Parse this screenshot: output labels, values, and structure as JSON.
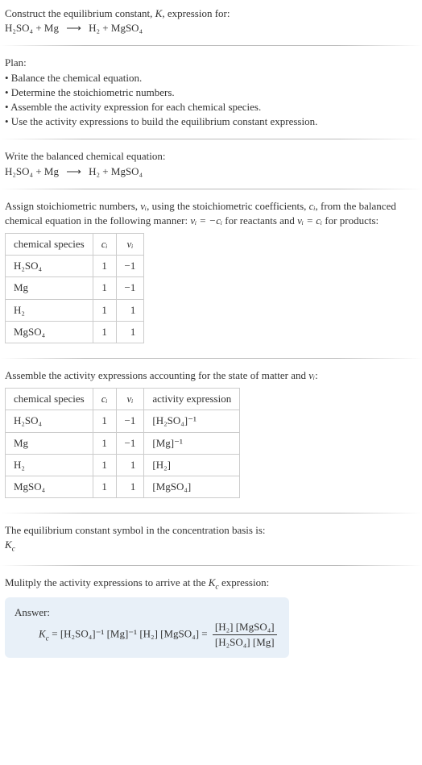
{
  "header": {
    "line1_pre": "Construct the equilibrium constant, ",
    "line1_K": "K",
    "line1_post": ", expression for:",
    "eq_lhs1": "H₂SO₄",
    "eq_plus": " + ",
    "eq_lhs2": "Mg",
    "eq_arrow": "⟶",
    "eq_rhs1": "H₂",
    "eq_rhs2": "MgSO₄"
  },
  "plan": {
    "title": "Plan:",
    "b1": "• Balance the chemical equation.",
    "b2": "• Determine the stoichiometric numbers.",
    "b3": "• Assemble the activity expression for each chemical species.",
    "b4": "• Use the activity expressions to build the equilibrium constant expression."
  },
  "balanced": {
    "title": "Write the balanced chemical equation:",
    "lhs1": "H₂SO₄",
    "plus": " + ",
    "lhs2": "Mg",
    "arrow": "⟶",
    "rhs1": "H₂",
    "rhs2": "MgSO₄"
  },
  "assign": {
    "p1a": "Assign stoichiometric numbers, ",
    "nu_i": "νᵢ",
    "p1b": ", using the stoichiometric coefficients, ",
    "c_i": "cᵢ",
    "p1c": ", from the balanced chemical equation in the following manner: ",
    "eq1": "νᵢ = −cᵢ",
    "p1d": " for reactants and ",
    "eq2": "νᵢ = cᵢ",
    "p1e": " for products:",
    "th1": "chemical species",
    "th2": "cᵢ",
    "th3": "νᵢ",
    "rows": [
      {
        "sp": "H₂SO₄",
        "c": "1",
        "n": "−1"
      },
      {
        "sp": "Mg",
        "c": "1",
        "n": "−1"
      },
      {
        "sp": "H₂",
        "c": "1",
        "n": "1"
      },
      {
        "sp": "MgSO₄",
        "c": "1",
        "n": "1"
      }
    ]
  },
  "activity": {
    "title_a": "Assemble the activity expressions accounting for the state of matter and ",
    "title_nu": "νᵢ",
    "title_b": ":",
    "th1": "chemical species",
    "th2": "cᵢ",
    "th3": "νᵢ",
    "th4": "activity expression",
    "rows": [
      {
        "sp": "H₂SO₄",
        "c": "1",
        "n": "−1",
        "act": "[H₂SO₄]⁻¹"
      },
      {
        "sp": "Mg",
        "c": "1",
        "n": "−1",
        "act": "[Mg]⁻¹"
      },
      {
        "sp": "H₂",
        "c": "1",
        "n": "1",
        "act": "[H₂]"
      },
      {
        "sp": "MgSO₄",
        "c": "1",
        "n": "1",
        "act": "[MgSO₄]"
      }
    ]
  },
  "symbol": {
    "line": "The equilibrium constant symbol in the concentration basis is:",
    "kc": "K",
    "kc_sub": "c"
  },
  "multiply": {
    "line_a": "Mulitply the activity expressions to arrive at the ",
    "kc": "K",
    "kc_sub": "c",
    "line_b": " expression:"
  },
  "answer": {
    "label": "Answer:",
    "kc": "K",
    "kc_sub": "c",
    "eq": " = ",
    "t1": "[H₂SO₄]⁻¹",
    "t2": "[Mg]⁻¹",
    "t3": "[H₂]",
    "t4": "[MgSO₄]",
    "eq2": " = ",
    "num": "[H₂] [MgSO₄]",
    "den": "[H₂SO₄] [Mg]"
  }
}
